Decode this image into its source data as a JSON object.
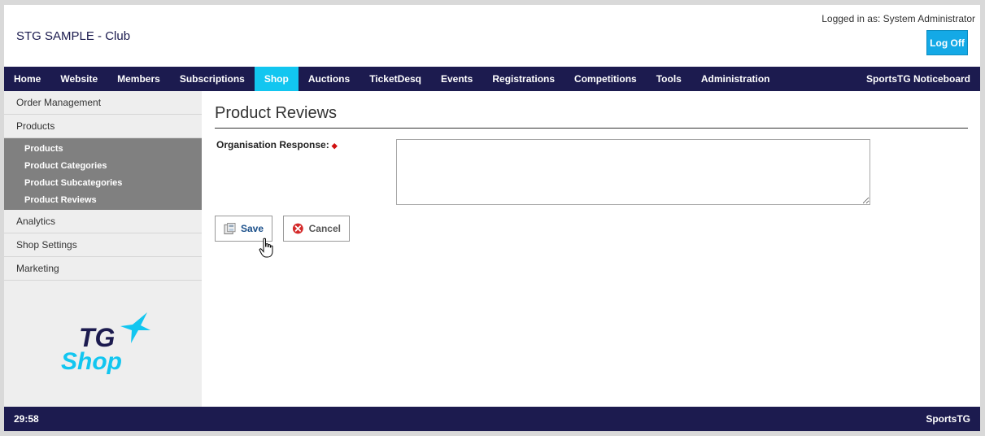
{
  "header": {
    "club_title": "STG SAMPLE - Club",
    "logged_in": "Logged in as: System Administrator",
    "logoff_label": "Log Off"
  },
  "nav": {
    "items": [
      "Home",
      "Website",
      "Members",
      "Subscriptions",
      "Shop",
      "Auctions",
      "TicketDesq",
      "Events",
      "Registrations",
      "Competitions",
      "Tools",
      "Administration"
    ],
    "active": "Shop",
    "right_label": "SportsTG Noticeboard"
  },
  "sidebar": {
    "items": [
      "Order Management",
      "Products",
      "Analytics",
      "Shop Settings",
      "Marketing"
    ],
    "sub_items": [
      "Products",
      "Product Categories",
      "Product Subcategories",
      "Product Reviews"
    ],
    "logo_top": "TG",
    "logo_bottom": "Shop"
  },
  "main": {
    "title": "Product Reviews",
    "field_label": "Organisation Response:",
    "required_mark": "◆",
    "response_value": "",
    "save_label": "Save",
    "cancel_label": "Cancel"
  },
  "footer": {
    "timer": "29:58",
    "brand": "SportsTG"
  },
  "colors": {
    "nav_bg": "#1c1b4f",
    "nav_active": "#12c6f0",
    "logoff_bg": "#14a9e6",
    "sub_menu_bg": "#808080"
  }
}
